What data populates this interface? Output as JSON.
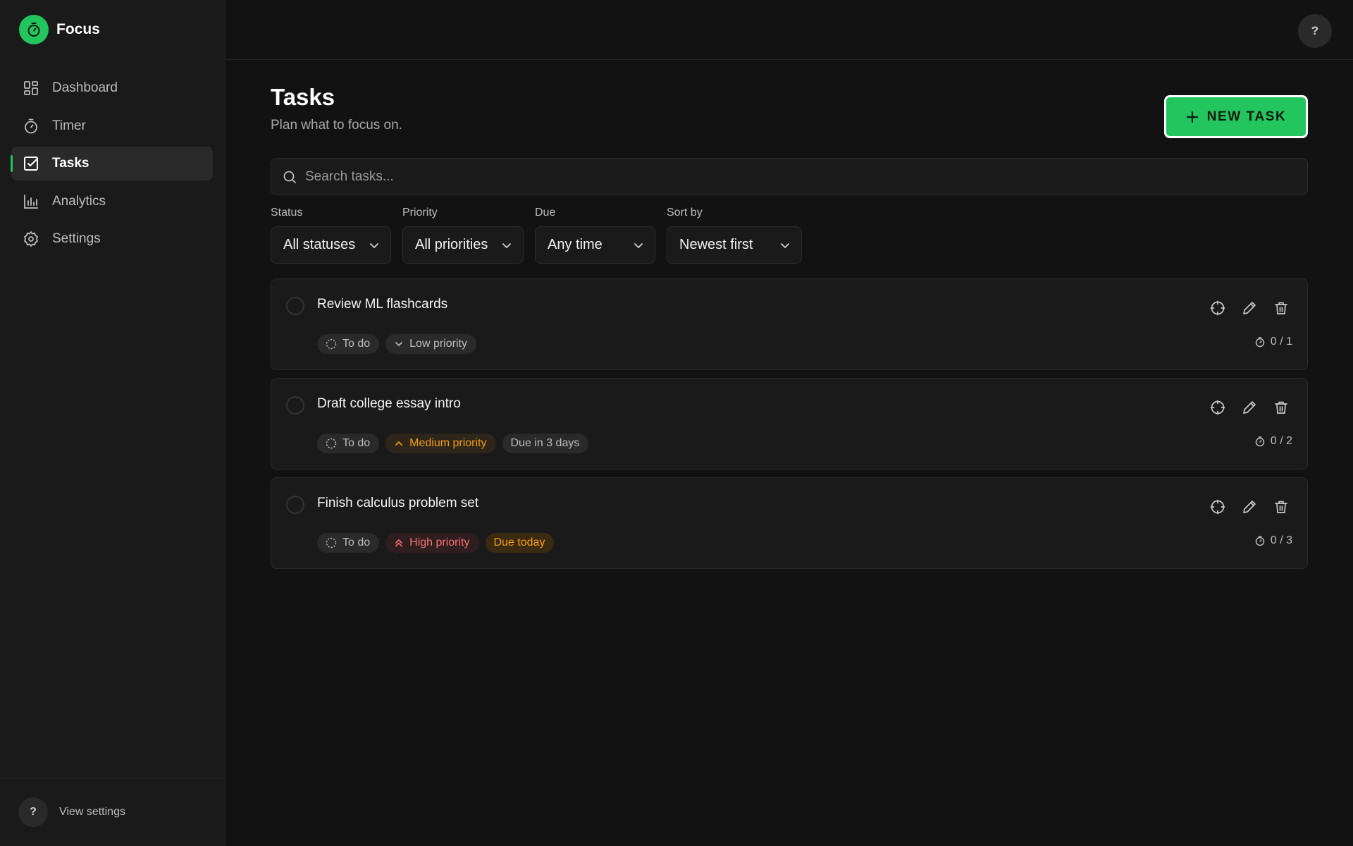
{
  "app": {
    "name": "Focus",
    "accent": "#22c55e"
  },
  "sidebar": {
    "items": [
      {
        "label": "Dashboard",
        "icon": "dashboard-icon"
      },
      {
        "label": "Timer",
        "icon": "timer-icon"
      },
      {
        "label": "Tasks",
        "icon": "tasks-icon",
        "active": true
      },
      {
        "label": "Analytics",
        "icon": "analytics-icon"
      },
      {
        "label": "Settings",
        "icon": "settings-icon"
      }
    ],
    "footer": {
      "help": "?",
      "label": "View settings"
    }
  },
  "topbar": {
    "help": "?"
  },
  "page": {
    "title": "Tasks",
    "subtitle": "Plan what to focus on.",
    "new_task_label": "NEW TASK"
  },
  "search": {
    "placeholder": "Search tasks...",
    "value": ""
  },
  "filters": [
    {
      "label": "Status",
      "value": "All statuses"
    },
    {
      "label": "Priority",
      "value": "All priorities"
    },
    {
      "label": "Due",
      "value": "Any time"
    },
    {
      "label": "Sort by",
      "value": "Newest first"
    }
  ],
  "tasks": [
    {
      "title": "Review ML flashcards",
      "status": "To do",
      "priority": "Low priority",
      "due": "",
      "pomodoros": "0 / 1"
    },
    {
      "title": "Draft college essay intro",
      "status": "To do",
      "priority": "Medium priority",
      "due": "Due in 3 days",
      "pomodoros": "0 / 2"
    },
    {
      "title": "Finish calculus problem set",
      "status": "To do",
      "priority": "High priority",
      "due": "Due today",
      "pomodoros": "0 / 3"
    }
  ]
}
